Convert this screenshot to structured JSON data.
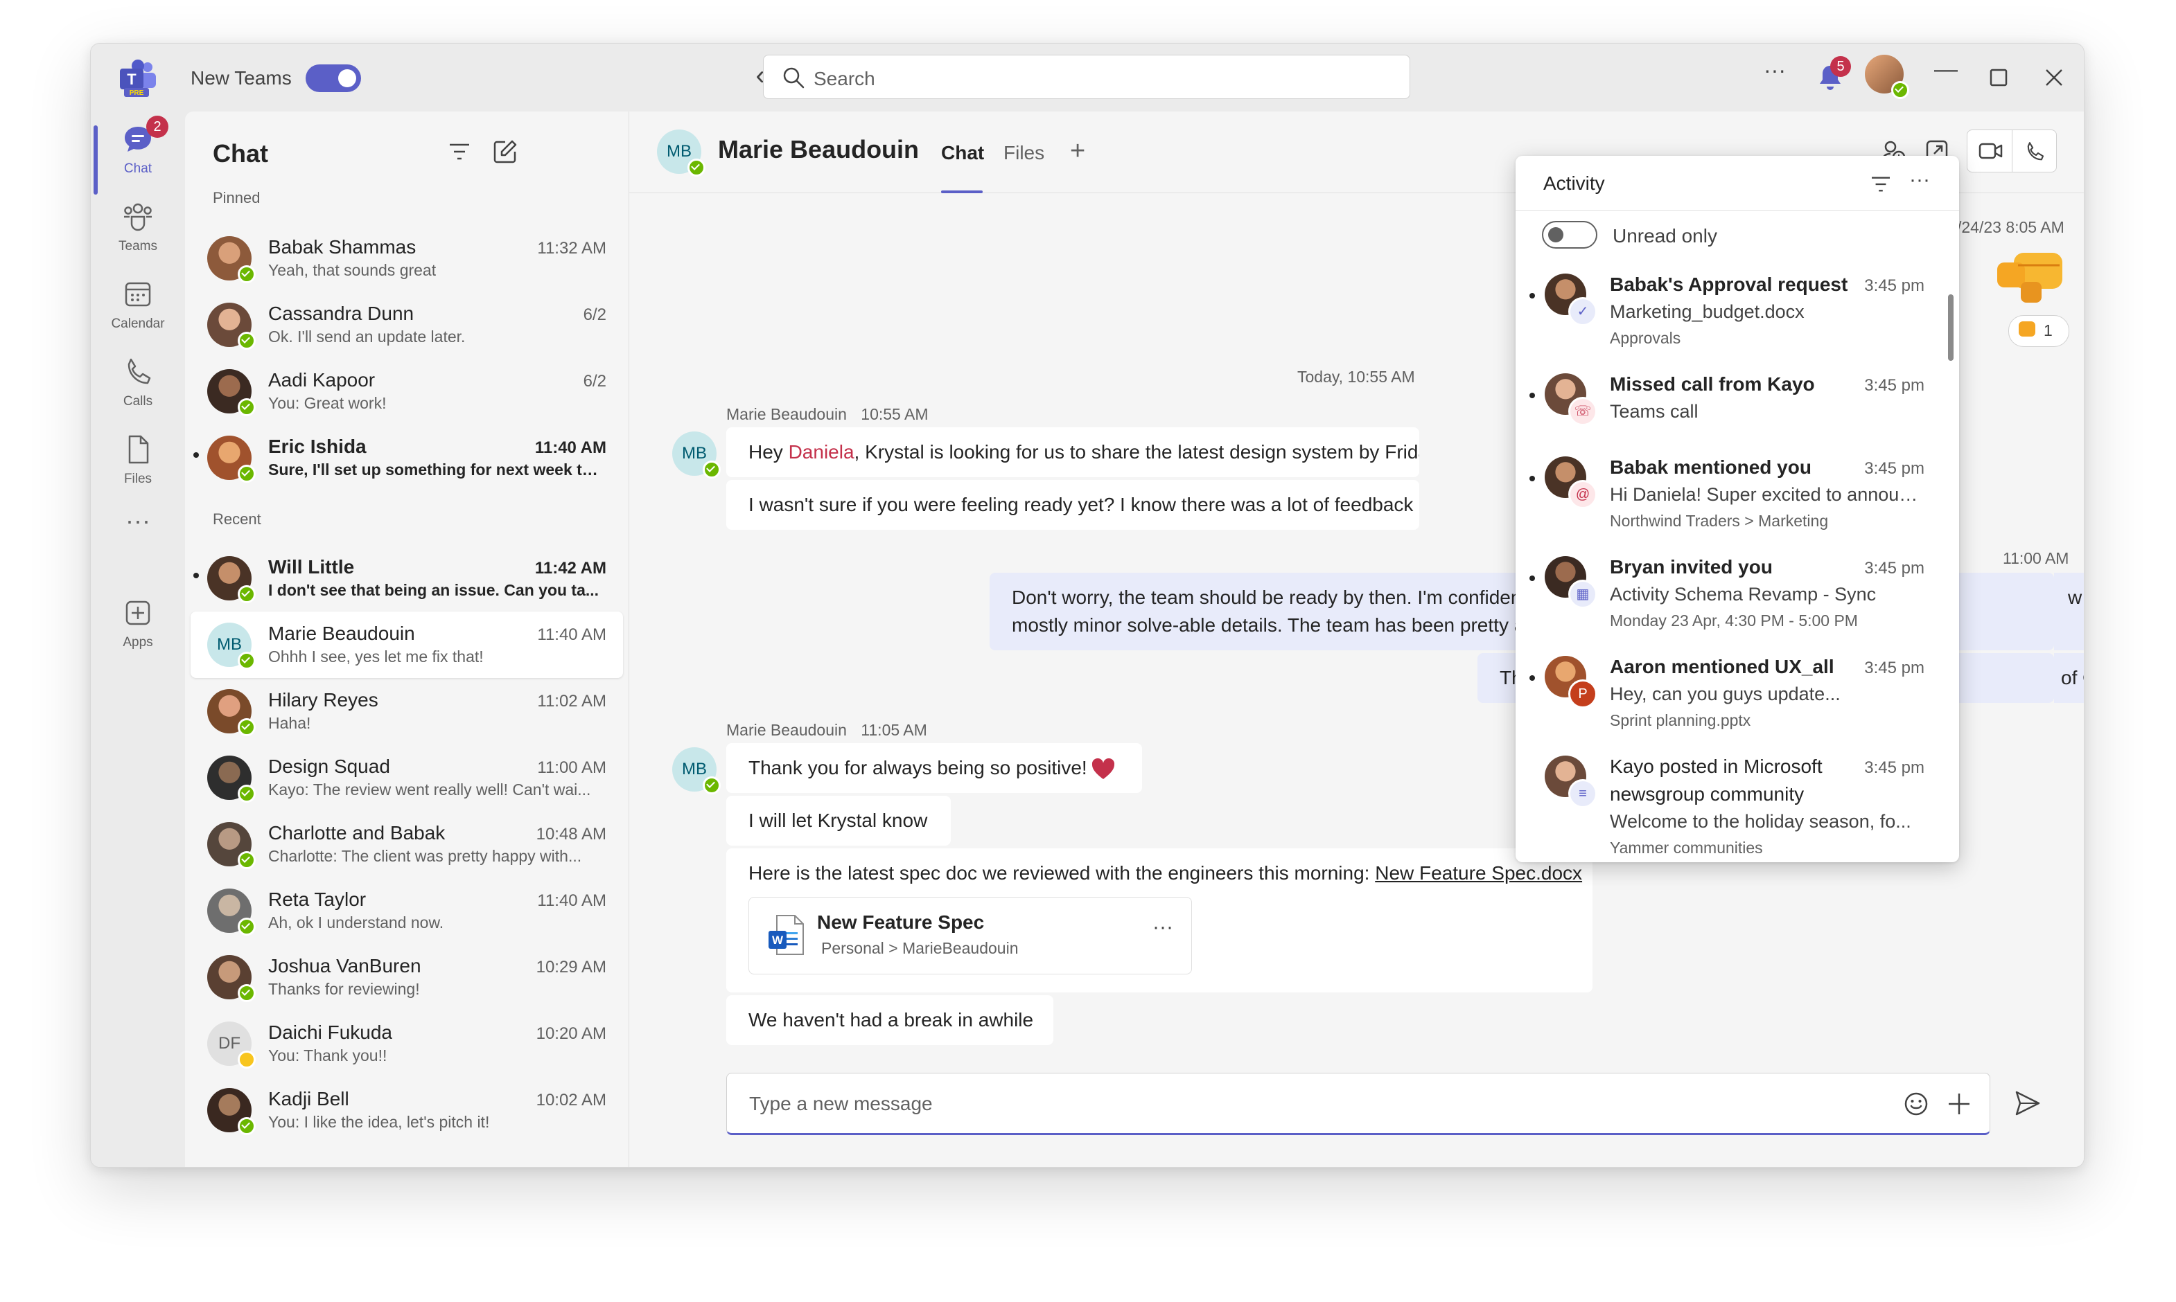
{
  "titlebar": {
    "new_teams_label": "New Teams",
    "new_teams_on": true,
    "search_placeholder": "Search",
    "notification_count": "5",
    "logo_text": "PRE"
  },
  "rail": {
    "items": [
      {
        "label": "Chat",
        "icon": "chat-icon",
        "badge": "2",
        "active": true
      },
      {
        "label": "Teams",
        "icon": "teams-icon"
      },
      {
        "label": "Calendar",
        "icon": "calendar-icon"
      },
      {
        "label": "Calls",
        "icon": "calls-icon"
      },
      {
        "label": "Files",
        "icon": "files-icon"
      },
      {
        "label": "",
        "icon": "more-icon"
      },
      {
        "label": "Apps",
        "icon": "apps-icon"
      }
    ]
  },
  "chatlist": {
    "title": "Chat",
    "pinned_label": "Pinned",
    "recent_label": "Recent",
    "pinned": [
      {
        "name": "Babak Shammas",
        "time": "11:32 AM",
        "preview": "Yeah, that sounds great"
      },
      {
        "name": "Cassandra Dunn",
        "time": "6/2",
        "preview": "Ok. I'll send an update later."
      },
      {
        "name": "Aadi Kapoor",
        "time": "6/2",
        "preview": "You: Great work!"
      },
      {
        "name": "Eric Ishida",
        "time": "11:40 AM",
        "preview": "Sure, I'll set up something for next week to...",
        "unread": true
      }
    ],
    "recent": [
      {
        "name": "Will Little",
        "time": "11:42 AM",
        "preview": "I don't see that being an issue. Can you ta...",
        "unread": true
      },
      {
        "name": "Marie Beaudouin",
        "initials": "MB",
        "time": "11:40 AM",
        "preview": "Ohhh I see, yes let me fix that!",
        "selected": true
      },
      {
        "name": "Hilary Reyes",
        "time": "11:02 AM",
        "preview": "Haha!"
      },
      {
        "name": "Design Squad",
        "time": "11:00 AM",
        "preview": "Kayo: The review went really well! Can't wai..."
      },
      {
        "name": "Charlotte and Babak",
        "time": "10:48 AM",
        "preview": "Charlotte: The client was pretty happy with..."
      },
      {
        "name": "Reta Taylor",
        "time": "11:40 AM",
        "preview": "Ah, ok I understand now."
      },
      {
        "name": "Joshua VanBuren",
        "time": "10:29 AM",
        "preview": "Thanks for reviewing!"
      },
      {
        "name": "Daichi Fukuda",
        "initials": "DF",
        "time": "10:20 AM",
        "preview": "You: Thank you!!",
        "away": true
      },
      {
        "name": "Kadji Bell",
        "time": "10:02 AM",
        "preview": "You: I like the idea, let's pitch it!"
      }
    ]
  },
  "conversation": {
    "contact_name": "Marie Beaudouin",
    "contact_initials": "MB",
    "tabs": [
      "Chat",
      "Files"
    ],
    "top_timestamp": "/24/23 8:05 AM",
    "reaction_count": "1",
    "divider": "Today, 10:55 AM",
    "group1": {
      "sender": "Marie Beaudouin",
      "time": "10:55 AM",
      "msg1_pre": "Hey ",
      "msg1_mention": "Daniela",
      "msg1_post": ", Krystal is looking for us to share the latest design system by Friday",
      "msg2": "I wasn't sure if you were feeling ready yet? I know there was a lot of feedback co"
    },
    "mine": {
      "time": "11:00 AM",
      "line1": "Don't worry, the team should be ready by then. I'm confident",
      "line1_tail": "w was",
      "line2": "mostly minor solve-able details. The team has been pretty aw",
      "msg2_head": "The",
      "msg2_tail": "of October"
    },
    "group2": {
      "sender": "Marie Beaudouin",
      "time": "11:05 AM",
      "msg1": "Thank you for always being so positive!",
      "msg2": "I will let Krystal know",
      "msg3_pre": "Here is the latest spec doc we reviewed with the engineers this morning: ",
      "msg3_link": "New Feature Spec.docx",
      "file_title": "New Feature Spec",
      "file_path": "Personal > MarieBeaudouin",
      "msg4": "We haven't had a break in awhile"
    },
    "composer_placeholder": "Type a new message"
  },
  "activity": {
    "title": "Activity",
    "unread_only_label": "Unread only",
    "unread_only_on": false,
    "items": [
      {
        "title": "Babak's Approval request",
        "time": "3:45 pm",
        "line2": "Marketing_budget.docx",
        "line3": "Approvals",
        "type": "approval-icon",
        "bold": true
      },
      {
        "title": "Missed call from Kayo",
        "time": "3:45 pm",
        "line2": "Teams call",
        "type": "missed-call-icon",
        "bold": true
      },
      {
        "title": "Babak mentioned you",
        "time": "3:45 pm",
        "line2": "Hi Daniela! Super excited to announce...",
        "line3": "Northwind Traders > Marketing",
        "type": "mention-icon",
        "bold": true
      },
      {
        "title": "Bryan invited you",
        "time": "3:45 pm",
        "line2": "Activity Schema Revamp - Sync",
        "line3": "Monday 23 Apr, 4:30 PM - 5:00 PM",
        "type": "calendar-icon",
        "bold": true
      },
      {
        "title": "Aaron mentioned UX_all",
        "time": "3:45 pm",
        "line2": "Hey, can you guys update...",
        "line3": "Sprint planning.pptx",
        "type": "powerpoint-icon",
        "bold": true
      },
      {
        "title": "Kayo posted in Microsoft",
        "time": "3:45 pm",
        "line2": "newsgroup community",
        "line3": "Welcome to the holiday season, fo...",
        "line4": "Yammer communities",
        "type": "post-icon",
        "bold": false
      }
    ]
  },
  "colors": {
    "brand": "#5b5fc7",
    "badge": "#c4314b",
    "presence_available": "#6bb700",
    "presence_away": "#f8c51e"
  }
}
